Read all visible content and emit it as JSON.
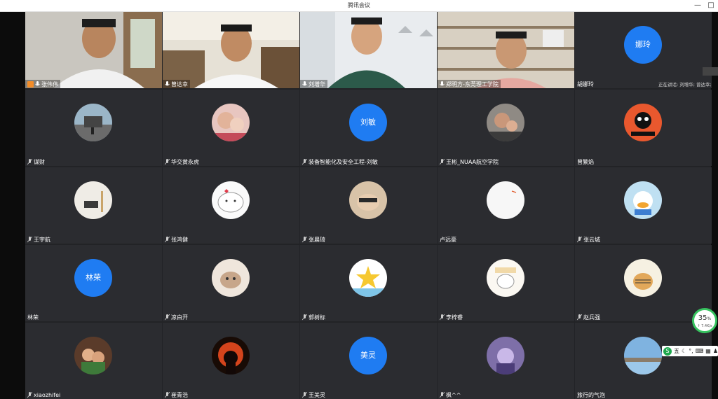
{
  "window": {
    "title": "腾讯会议",
    "minimize": "—",
    "maximize": "□"
  },
  "speaking_text": "正在讲话: 刘增华; 曾达幸;",
  "network": {
    "percent": "35",
    "percent_unit": "%",
    "speed": "↑ 7.4K/s"
  },
  "ime": {
    "logo": "S",
    "mode": "五"
  },
  "colors": {
    "initial_avatar": "#1f7cf2",
    "tile_bg": "#2b2c30",
    "grid_bg": "#222326"
  },
  "tiles": [
    {
      "name": "张伟伟",
      "host": true,
      "type": "video"
    },
    {
      "name": "曾达幸",
      "type": "video"
    },
    {
      "name": "刘增华",
      "type": "video"
    },
    {
      "name": "郑明方-东莞理工学院",
      "type": "video"
    },
    {
      "name": "胡娜玲",
      "type": "initial",
      "initial": "娜玲"
    },
    {
      "name": "谋财",
      "type": "photo"
    },
    {
      "name": "华交黄永虎",
      "type": "photo"
    },
    {
      "name": "装备智能化及安全工程-刘敏",
      "type": "initial",
      "initial": "刘敏"
    },
    {
      "name": "王彬_NUAA航空学院",
      "type": "photo"
    },
    {
      "name": "曾繁焰",
      "type": "photo"
    },
    {
      "name": "王宇航",
      "type": "photo"
    },
    {
      "name": "张鸿健",
      "type": "photo"
    },
    {
      "name": "张晨琦",
      "type": "photo"
    },
    {
      "name": "卢远豪",
      "type": "photo"
    },
    {
      "name": "张云城",
      "type": "photo"
    },
    {
      "name": "林荣",
      "type": "initial",
      "initial": "林荣"
    },
    {
      "name": "凉白开",
      "type": "photo"
    },
    {
      "name": "郭树标",
      "type": "photo"
    },
    {
      "name": "李梓睿",
      "type": "photo"
    },
    {
      "name": "赵兵强",
      "type": "photo"
    },
    {
      "name": "xiaozhifei",
      "type": "photo"
    },
    {
      "name": "崔青浩",
      "type": "photo"
    },
    {
      "name": "王美灵",
      "type": "initial",
      "initial": "美灵"
    },
    {
      "name": "枫^^",
      "type": "photo"
    },
    {
      "name": "旅行的气泡",
      "type": "photo"
    }
  ]
}
